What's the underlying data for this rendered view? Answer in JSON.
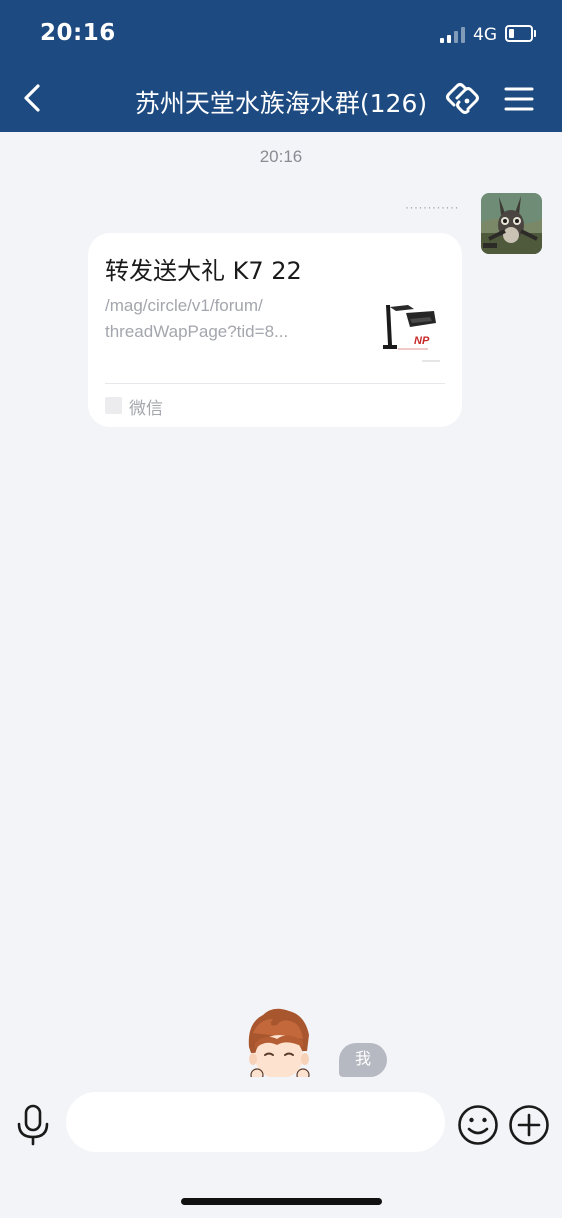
{
  "status_bar": {
    "time": "20:16",
    "network": "4G",
    "battery_level": 0.2
  },
  "header": {
    "title": "苏州天堂水族海水群(126)",
    "back_icon": "chevron-left-icon",
    "link_icon": "link-icon",
    "menu_icon": "menu-icon",
    "background": "#1d4a80"
  },
  "chat": {
    "timestamp": "20:16",
    "messages": [
      {
        "sender_name": "············",
        "avatar_icon": "user-avatar",
        "card": {
          "title": "转发送大礼 K7 22",
          "desc_line1": "/mag/circle/v1/forum/",
          "desc_line2": "threadWapPage?tid=8...",
          "thumbnail": "aquarium-light-thumbnail",
          "thumb_brand_text": "NP",
          "source": "微信"
        }
      }
    ],
    "me_badge": "我"
  },
  "input_bar": {
    "placeholder": "",
    "value": "",
    "voice_icon": "microphone-icon",
    "emoji_icon": "emoji-icon",
    "plus_icon": "plus-icon"
  }
}
